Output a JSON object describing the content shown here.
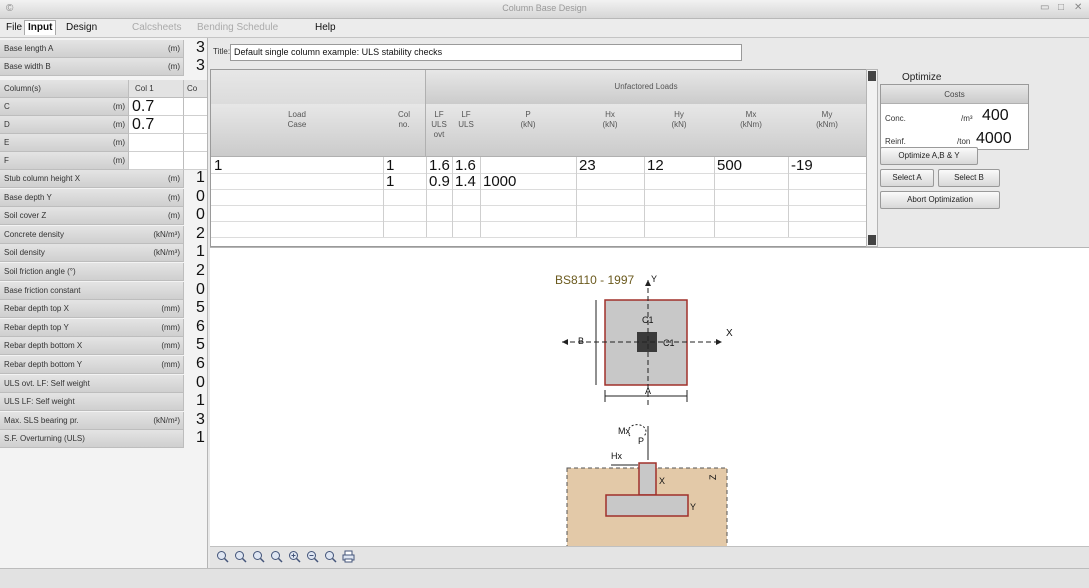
{
  "window": {
    "title": "Column Base Design"
  },
  "menu": [
    {
      "label": "File",
      "state": "normal"
    },
    {
      "label": "Input",
      "state": "active"
    },
    {
      "label": "Design",
      "state": "normal"
    },
    {
      "label": "Calcsheets",
      "state": "disabled"
    },
    {
      "label": "Bending Schedule",
      "state": "disabled"
    },
    {
      "label": "Help",
      "state": "normal"
    }
  ],
  "left_panel": {
    "rows_top": [
      {
        "label": "Base length A",
        "unit": "(m)",
        "value": "3"
      },
      {
        "label": "Base width B",
        "unit": "(m)",
        "value": "3"
      }
    ],
    "columns_header": {
      "label": "Column(s)",
      "col1": "Col 1",
      "col2": "Co"
    },
    "column_rows": [
      {
        "label": "C",
        "unit": "(m)",
        "value": "0.7"
      },
      {
        "label": "D",
        "unit": "(m)",
        "value": "0.7"
      },
      {
        "label": "E",
        "unit": "(m)",
        "value": ""
      },
      {
        "label": "F",
        "unit": "(m)",
        "value": ""
      }
    ],
    "rows_bottom": [
      {
        "label": "Stub column height X",
        "unit": "(m)",
        "value": "1"
      },
      {
        "label": "Base depth Y",
        "unit": "(m)",
        "value": "0"
      },
      {
        "label": "Soil cover Z",
        "unit": "(m)",
        "value": "0"
      },
      {
        "label": "Concrete density",
        "unit": "(kN/m³)",
        "value": "2"
      },
      {
        "label": "Soil density",
        "unit": "(kN/m³)",
        "value": "1"
      },
      {
        "label": "Soil friction angle (°)",
        "unit": "",
        "value": "2"
      },
      {
        "label": "Base friction constant",
        "unit": "",
        "value": "0"
      },
      {
        "label": "Rebar depth top X",
        "unit": "(mm)",
        "value": "5"
      },
      {
        "label": "Rebar depth top Y",
        "unit": "(mm)",
        "value": "6"
      },
      {
        "label": "Rebar depth bottom X",
        "unit": "(mm)",
        "value": "5"
      },
      {
        "label": "Rebar depth bottom Y",
        "unit": "(mm)",
        "value": "6"
      },
      {
        "label": "ULS ovt. LF: Self weight",
        "unit": "",
        "value": "0"
      },
      {
        "label": "ULS LF: Self weight",
        "unit": "",
        "value": "1"
      },
      {
        "label": "Max. SLS bearing pr.",
        "unit": "(kN/m²)",
        "value": "3"
      },
      {
        "label": "S.F. Overturning (ULS)",
        "unit": "",
        "value": "1"
      }
    ]
  },
  "title_field": {
    "label": "Title:",
    "value": "Default single column example: ULS stability checks"
  },
  "load_table": {
    "group_header": "Unfactored Loads",
    "headers": {
      "load_case": [
        "Load",
        "Case"
      ],
      "col": [
        "Col",
        "no."
      ],
      "lf_uls_ovt": [
        "LF",
        "ULS",
        "ovt"
      ],
      "lf_uls": [
        "LF",
        "ULS"
      ],
      "p": [
        "P",
        "(kN)"
      ],
      "hx": [
        "Hx",
        "(kN)"
      ],
      "hy": [
        "Hy",
        "(kN)"
      ],
      "mx": [
        "Mx",
        "(kNm)"
      ],
      "my": [
        "My",
        "(kNm)"
      ]
    },
    "rows": [
      {
        "case": "1",
        "col": "1",
        "lf_ovt": "1.6",
        "lf_uls": "1.6",
        "p": "",
        "hx": "23",
        "hy": "12",
        "mx": "500",
        "my": "-19"
      },
      {
        "case": "",
        "col": "1",
        "lf_ovt": "0.9",
        "lf_uls": "1.4",
        "p": "1000",
        "hx": "",
        "hy": "",
        "mx": "",
        "my": ""
      }
    ]
  },
  "optimize": {
    "title": "Optimize",
    "costs_header": "Costs",
    "conc_label": "Conc.",
    "conc_unit": "/m³",
    "conc_value": "400",
    "reinf_label": "Reinf.",
    "reinf_unit": "/ton",
    "reinf_value": "4000",
    "buttons": {
      "optimize_ab_y": "Optimize A,B & Y",
      "select_a": "Select A",
      "select_b": "Select B",
      "abort": "Abort Optimization"
    }
  },
  "drawing": {
    "code_label": "BS8110 - 1997",
    "plan_labels": {
      "c1_top": "C1",
      "c1_right": "C1",
      "axis_x": "X",
      "axis_y": "Y",
      "label_a": "A",
      "label_b": "B"
    },
    "section_labels": {
      "mx": "Mx",
      "p": "P",
      "hx": "Hx",
      "x": "X",
      "y": "Y",
      "z": "Z"
    }
  },
  "zoom_toolbar": [
    "zoom-window-icon",
    "zoom-all-icon",
    "zoom-extents-icon",
    "zoom-previous-icon",
    "zoom-in-icon",
    "zoom-out-icon",
    "zoom-realtime-icon",
    "print-icon"
  ],
  "colors": {
    "base_fill": "#c8c8c8",
    "column_fill": "#3a3a3a",
    "soil_fill": "#e3c9a8",
    "outline": "#a0302a",
    "accent_label": "#6b5a1e"
  }
}
